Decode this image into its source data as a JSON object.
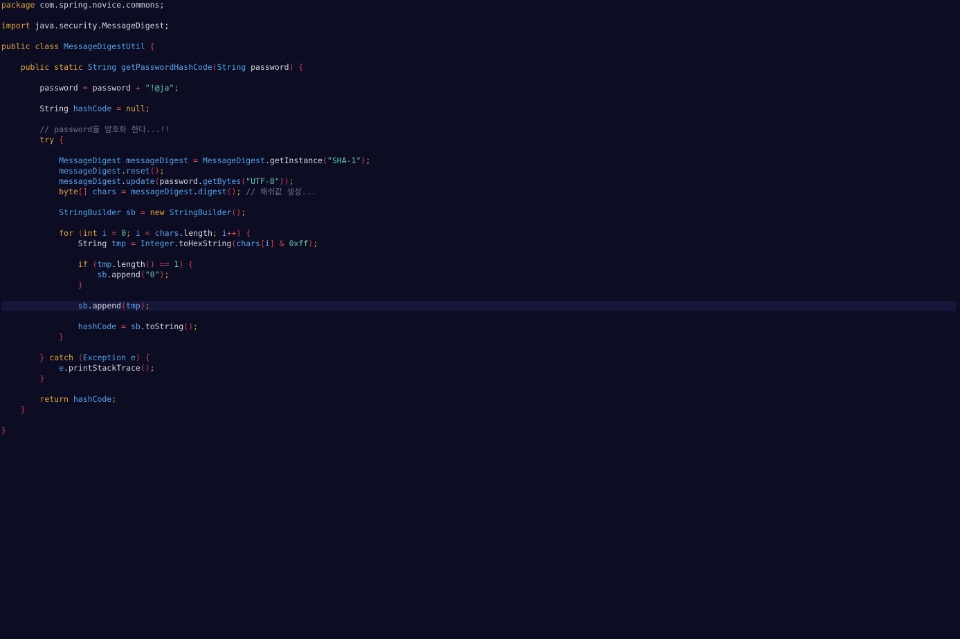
{
  "editor": {
    "colors": {
      "background": "#0c0c22",
      "current_line": "#15163a",
      "keyword": "#e0a53a",
      "type": "#4fa3e8",
      "variable": "#5aa0e6",
      "string": "#66c9b3",
      "operator": "#d14f5e",
      "bracket": "#d1404c",
      "comment": "#6f7488",
      "plain": "#d2d7e0"
    },
    "current_line_index": 29,
    "lines": [
      [
        {
          "t": "kw",
          "v": "package"
        },
        {
          "t": "pl",
          "v": " com.spring.novice.commons;"
        }
      ],
      [],
      [
        {
          "t": "kw",
          "v": "import"
        },
        {
          "t": "pl",
          "v": " java.security.MessageDigest;"
        }
      ],
      [],
      [
        {
          "t": "kw",
          "v": "public class"
        },
        {
          "t": "pl",
          "v": " "
        },
        {
          "t": "ty",
          "v": "MessageDigestUtil"
        },
        {
          "t": "pl",
          "v": " "
        },
        {
          "t": "br",
          "v": "{"
        }
      ],
      [],
      [
        {
          "t": "pl",
          "v": "    "
        },
        {
          "t": "kw",
          "v": "public static"
        },
        {
          "t": "pl",
          "v": " "
        },
        {
          "t": "ty",
          "v": "String"
        },
        {
          "t": "pl",
          "v": " "
        },
        {
          "t": "vr",
          "v": "getPasswordHashCode"
        },
        {
          "t": "br",
          "v": "("
        },
        {
          "t": "ty",
          "v": "String"
        },
        {
          "t": "pl",
          "v": " password"
        },
        {
          "t": "br",
          "v": ")"
        },
        {
          "t": "pl",
          "v": " "
        },
        {
          "t": "br",
          "v": "{"
        }
      ],
      [],
      [
        {
          "t": "pl",
          "v": "        password "
        },
        {
          "t": "op",
          "v": "="
        },
        {
          "t": "pl",
          "v": " password "
        },
        {
          "t": "op",
          "v": "+"
        },
        {
          "t": "pl",
          "v": " "
        },
        {
          "t": "st",
          "v": "\"!@ja\""
        },
        {
          "t": "kw",
          "v": ";"
        }
      ],
      [],
      [
        {
          "t": "pl",
          "v": "        String "
        },
        {
          "t": "vr",
          "v": "hashCode"
        },
        {
          "t": "pl",
          "v": " "
        },
        {
          "t": "op",
          "v": "="
        },
        {
          "t": "pl",
          "v": " "
        },
        {
          "t": "kw",
          "v": "null;"
        }
      ],
      [],
      [
        {
          "t": "cm",
          "v": "        // password를 암호화 한다...!!"
        }
      ],
      [
        {
          "t": "pl",
          "v": "        "
        },
        {
          "t": "kw",
          "v": "try"
        },
        {
          "t": "pl",
          "v": " "
        },
        {
          "t": "br",
          "v": "{"
        }
      ],
      [],
      [
        {
          "t": "pl",
          "v": "            "
        },
        {
          "t": "ty",
          "v": "MessageDigest"
        },
        {
          "t": "pl",
          "v": " "
        },
        {
          "t": "vr",
          "v": "messageDigest"
        },
        {
          "t": "pl",
          "v": " "
        },
        {
          "t": "op",
          "v": "="
        },
        {
          "t": "pl",
          "v": " "
        },
        {
          "t": "ty",
          "v": "MessageDigest"
        },
        {
          "t": "pl",
          "v": ".getInstance"
        },
        {
          "t": "br",
          "v": "("
        },
        {
          "t": "st",
          "v": "\"SHA-1\""
        },
        {
          "t": "br",
          "v": ")"
        },
        {
          "t": "kw",
          "v": ";"
        }
      ],
      [
        {
          "t": "pl",
          "v": "            "
        },
        {
          "t": "vr",
          "v": "messageDigest"
        },
        {
          "t": "pl",
          "v": "."
        },
        {
          "t": "vr",
          "v": "reset"
        },
        {
          "t": "br",
          "v": "()"
        },
        {
          "t": "kw",
          "v": ";"
        }
      ],
      [
        {
          "t": "pl",
          "v": "            "
        },
        {
          "t": "vr",
          "v": "messageDigest"
        },
        {
          "t": "pl",
          "v": "."
        },
        {
          "t": "vr",
          "v": "update"
        },
        {
          "t": "br",
          "v": "("
        },
        {
          "t": "pl",
          "v": "password."
        },
        {
          "t": "vr",
          "v": "getBytes"
        },
        {
          "t": "br",
          "v": "("
        },
        {
          "t": "st",
          "v": "\"UTF-8\""
        },
        {
          "t": "br",
          "v": "))"
        },
        {
          "t": "kw",
          "v": ";"
        }
      ],
      [
        {
          "t": "pl",
          "v": "            "
        },
        {
          "t": "kw",
          "v": "byte"
        },
        {
          "t": "br",
          "v": "[]"
        },
        {
          "t": "pl",
          "v": " "
        },
        {
          "t": "vr",
          "v": "chars"
        },
        {
          "t": "pl",
          "v": " "
        },
        {
          "t": "op",
          "v": "="
        },
        {
          "t": "pl",
          "v": " "
        },
        {
          "t": "vr",
          "v": "messageDigest"
        },
        {
          "t": "pl",
          "v": "."
        },
        {
          "t": "vr",
          "v": "digest"
        },
        {
          "t": "br",
          "v": "()"
        },
        {
          "t": "kw",
          "v": ";"
        },
        {
          "t": "cm",
          "v": " // 해쉬값 생성..."
        }
      ],
      [],
      [
        {
          "t": "pl",
          "v": "            "
        },
        {
          "t": "ty",
          "v": "StringBuilder"
        },
        {
          "t": "pl",
          "v": " "
        },
        {
          "t": "vr",
          "v": "sb"
        },
        {
          "t": "pl",
          "v": " "
        },
        {
          "t": "op",
          "v": "="
        },
        {
          "t": "pl",
          "v": " "
        },
        {
          "t": "kw",
          "v": "new"
        },
        {
          "t": "pl",
          "v": " "
        },
        {
          "t": "ty",
          "v": "StringBuilder"
        },
        {
          "t": "br",
          "v": "()"
        },
        {
          "t": "kw",
          "v": ";"
        }
      ],
      [],
      [
        {
          "t": "pl",
          "v": "            "
        },
        {
          "t": "kw",
          "v": "for"
        },
        {
          "t": "pl",
          "v": " "
        },
        {
          "t": "br",
          "v": "("
        },
        {
          "t": "kw",
          "v": "int"
        },
        {
          "t": "pl",
          "v": " "
        },
        {
          "t": "vr",
          "v": "i"
        },
        {
          "t": "pl",
          "v": " "
        },
        {
          "t": "op",
          "v": "="
        },
        {
          "t": "pl",
          "v": " "
        },
        {
          "t": "nm",
          "v": "0"
        },
        {
          "t": "kw",
          "v": ";"
        },
        {
          "t": "pl",
          "v": " "
        },
        {
          "t": "vr",
          "v": "i"
        },
        {
          "t": "pl",
          "v": " "
        },
        {
          "t": "op",
          "v": "<"
        },
        {
          "t": "pl",
          "v": " "
        },
        {
          "t": "vr",
          "v": "chars"
        },
        {
          "t": "pl",
          "v": ".length"
        },
        {
          "t": "kw",
          "v": ";"
        },
        {
          "t": "pl",
          "v": " "
        },
        {
          "t": "vr",
          "v": "i"
        },
        {
          "t": "op",
          "v": "++"
        },
        {
          "t": "br",
          "v": ")"
        },
        {
          "t": "pl",
          "v": " "
        },
        {
          "t": "br",
          "v": "{"
        }
      ],
      [
        {
          "t": "pl",
          "v": "                String "
        },
        {
          "t": "vr",
          "v": "tmp"
        },
        {
          "t": "pl",
          "v": " "
        },
        {
          "t": "op",
          "v": "="
        },
        {
          "t": "pl",
          "v": " "
        },
        {
          "t": "ty",
          "v": "Integer"
        },
        {
          "t": "pl",
          "v": ".toHexString"
        },
        {
          "t": "br",
          "v": "("
        },
        {
          "t": "vr",
          "v": "chars"
        },
        {
          "t": "br",
          "v": "["
        },
        {
          "t": "vr",
          "v": "i"
        },
        {
          "t": "br",
          "v": "]"
        },
        {
          "t": "pl",
          "v": " "
        },
        {
          "t": "op",
          "v": "&"
        },
        {
          "t": "pl",
          "v": " "
        },
        {
          "t": "nm",
          "v": "0xff"
        },
        {
          "t": "br",
          "v": ")"
        },
        {
          "t": "kw",
          "v": ";"
        }
      ],
      [],
      [
        {
          "t": "pl",
          "v": "                "
        },
        {
          "t": "kw",
          "v": "if"
        },
        {
          "t": "pl",
          "v": " "
        },
        {
          "t": "br",
          "v": "("
        },
        {
          "t": "vr",
          "v": "tmp"
        },
        {
          "t": "pl",
          "v": ".length"
        },
        {
          "t": "br",
          "v": "()"
        },
        {
          "t": "pl",
          "v": " "
        },
        {
          "t": "op",
          "v": "=="
        },
        {
          "t": "pl",
          "v": " "
        },
        {
          "t": "nm",
          "v": "1"
        },
        {
          "t": "br",
          "v": ")"
        },
        {
          "t": "pl",
          "v": " "
        },
        {
          "t": "br",
          "v": "{"
        }
      ],
      [
        {
          "t": "pl",
          "v": "                    "
        },
        {
          "t": "vr",
          "v": "sb"
        },
        {
          "t": "pl",
          "v": ".append"
        },
        {
          "t": "br",
          "v": "("
        },
        {
          "t": "st",
          "v": "\"0\""
        },
        {
          "t": "br",
          "v": ")"
        },
        {
          "t": "kw",
          "v": ";"
        }
      ],
      [
        {
          "t": "pl",
          "v": "                "
        },
        {
          "t": "br",
          "v": "}"
        }
      ],
      [],
      [
        {
          "t": "pl",
          "v": "                "
        },
        {
          "t": "vr",
          "v": "sb"
        },
        {
          "t": "pl",
          "v": ".append"
        },
        {
          "t": "br",
          "v": "("
        },
        {
          "t": "vr",
          "v": "tmp"
        },
        {
          "t": "br",
          "v": ")"
        },
        {
          "t": "kw",
          "v": ";"
        }
      ],
      [],
      [
        {
          "t": "pl",
          "v": "                "
        },
        {
          "t": "vr",
          "v": "hashCode"
        },
        {
          "t": "pl",
          "v": " "
        },
        {
          "t": "op",
          "v": "="
        },
        {
          "t": "pl",
          "v": " "
        },
        {
          "t": "vr",
          "v": "sb"
        },
        {
          "t": "pl",
          "v": ".toString"
        },
        {
          "t": "br",
          "v": "()"
        },
        {
          "t": "kw",
          "v": ";"
        }
      ],
      [
        {
          "t": "pl",
          "v": "            "
        },
        {
          "t": "br",
          "v": "}"
        }
      ],
      [],
      [
        {
          "t": "pl",
          "v": "        "
        },
        {
          "t": "br",
          "v": "}"
        },
        {
          "t": "pl",
          "v": " "
        },
        {
          "t": "kw",
          "v": "catch"
        },
        {
          "t": "pl",
          "v": " "
        },
        {
          "t": "br",
          "v": "("
        },
        {
          "t": "ty",
          "v": "Exception"
        },
        {
          "t": "pl",
          "v": " "
        },
        {
          "t": "vr",
          "v": "e"
        },
        {
          "t": "br",
          "v": ")"
        },
        {
          "t": "pl",
          "v": " "
        },
        {
          "t": "br",
          "v": "{"
        }
      ],
      [
        {
          "t": "pl",
          "v": "            "
        },
        {
          "t": "vr",
          "v": "e"
        },
        {
          "t": "pl",
          "v": ".printStackTrace"
        },
        {
          "t": "br",
          "v": "()"
        },
        {
          "t": "kw",
          "v": ";"
        }
      ],
      [
        {
          "t": "pl",
          "v": "        "
        },
        {
          "t": "br",
          "v": "}"
        }
      ],
      [],
      [
        {
          "t": "pl",
          "v": "        "
        },
        {
          "t": "kw",
          "v": "return"
        },
        {
          "t": "pl",
          "v": " "
        },
        {
          "t": "vr",
          "v": "hashCode"
        },
        {
          "t": "kw",
          "v": ";"
        }
      ],
      [
        {
          "t": "pl",
          "v": "    "
        },
        {
          "t": "br",
          "v": "}"
        }
      ],
      [],
      [
        {
          "t": "br",
          "v": "}"
        }
      ]
    ]
  }
}
